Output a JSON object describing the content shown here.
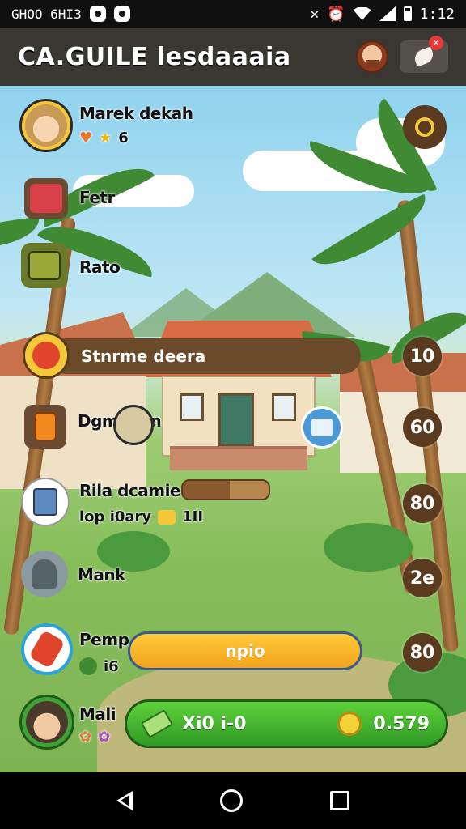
{
  "status_bar": {
    "left_text": "GHOO 6HI3",
    "time": "1:12",
    "icons": [
      "chat-bubble-icon",
      "chat-bubble-icon",
      "mute-icon",
      "alarm-icon",
      "wifi-icon",
      "signal-icon",
      "battery-icon"
    ]
  },
  "header": {
    "title": "CA.GUILE lesdaaaia",
    "avatar_icon": "profile-avatar-icon",
    "messages_icon": "leaf-message-icon",
    "badge_icon": "close-badge-icon"
  },
  "player": {
    "name": "Marek dekah",
    "stars": "6",
    "badge_icon": "shield-badge-icon"
  },
  "rows": [
    {
      "name": "Fetr",
      "icon": "chest-icon"
    },
    {
      "name": "Rato",
      "icon": "mailbox-icon"
    },
    {
      "name": "Stnrme deera",
      "icon": "apple-icon",
      "score": "10"
    },
    {
      "name": "Dgmoean",
      "icon": "book-icon",
      "score": "60"
    },
    {
      "name": "Rila dcamie",
      "sub": "lop i0ary",
      "sub_count": "1II",
      "icon": "canister-icon",
      "score": "80",
      "progress": 0.55
    },
    {
      "name": "Mank",
      "icon": "ghost-icon",
      "score": "2e"
    },
    {
      "name": "Pemp",
      "sub": "i6",
      "icon": "spray-icon",
      "score": "80"
    },
    {
      "name": "Mali",
      "icon": "friend-avatar-icon"
    }
  ],
  "buttons": {
    "orange_label": "npio",
    "green_cash_label": "Xi0 i-0",
    "green_coin_label": "0.579"
  },
  "colors": {
    "header_bg": "#3a3733",
    "score_bg": "#5a3b1f",
    "orange_button": "#f2a51d",
    "green_button": "#2f9a24"
  }
}
